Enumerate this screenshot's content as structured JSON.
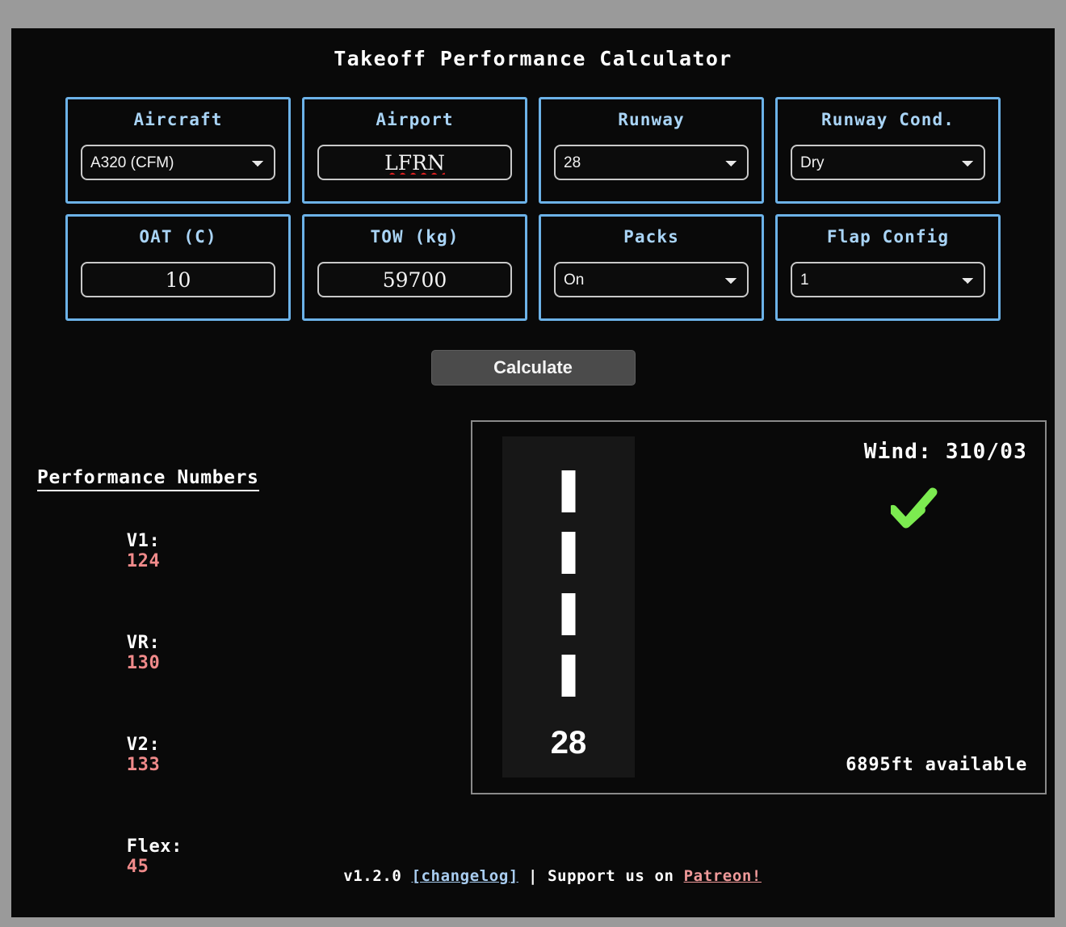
{
  "app": {
    "title": "Takeoff Performance Calculator",
    "background_color": "#9a9a9a",
    "panel_color": "#090909",
    "accent_color": "#6cb2e8",
    "label_color": "#a9d4f6",
    "value_color": "#f08a8a",
    "wind_arrow_color": "#7ceb50"
  },
  "form": {
    "fields": [
      {
        "label": "Aircraft",
        "type": "select",
        "value": "A320 (CFM)",
        "icon": "chevron-down-icon"
      },
      {
        "label": "Airport",
        "type": "text",
        "value": "LFRN",
        "misspelled": true
      },
      {
        "label": "Runway",
        "type": "select",
        "value": "28",
        "icon": "chevron-down-icon"
      },
      {
        "label": "Runway Cond.",
        "type": "select",
        "value": "Dry",
        "icon": "chevron-down-icon"
      },
      {
        "label": "OAT (C)",
        "type": "text",
        "value": "10",
        "misspelled": false
      },
      {
        "label": "TOW (kg)",
        "type": "text",
        "value": "59700",
        "misspelled": false
      },
      {
        "label": "Packs",
        "type": "select",
        "value": "On",
        "icon": "chevron-down-icon"
      },
      {
        "label": "Flap Config",
        "type": "select",
        "value": "1",
        "icon": "chevron-down-icon"
      }
    ],
    "calculate_label": "Calculate"
  },
  "performance": {
    "heading": "Performance Numbers",
    "rows": [
      {
        "label": "V1:",
        "value": "124"
      },
      {
        "label": "VR:",
        "value": "130"
      },
      {
        "label": "V2:",
        "value": "133"
      },
      {
        "label": "Flex:",
        "value": "45"
      }
    ]
  },
  "runway_view": {
    "wind": "Wind: 310/03",
    "runway_ident": "28",
    "available": "6895ft available",
    "centerline_dash_count": 4
  },
  "footer": {
    "version": "v1.2.0",
    "changelog_label": "[changelog]",
    "separator": "|",
    "support_text": "Support us on",
    "patreon_label": "Patreon!"
  }
}
